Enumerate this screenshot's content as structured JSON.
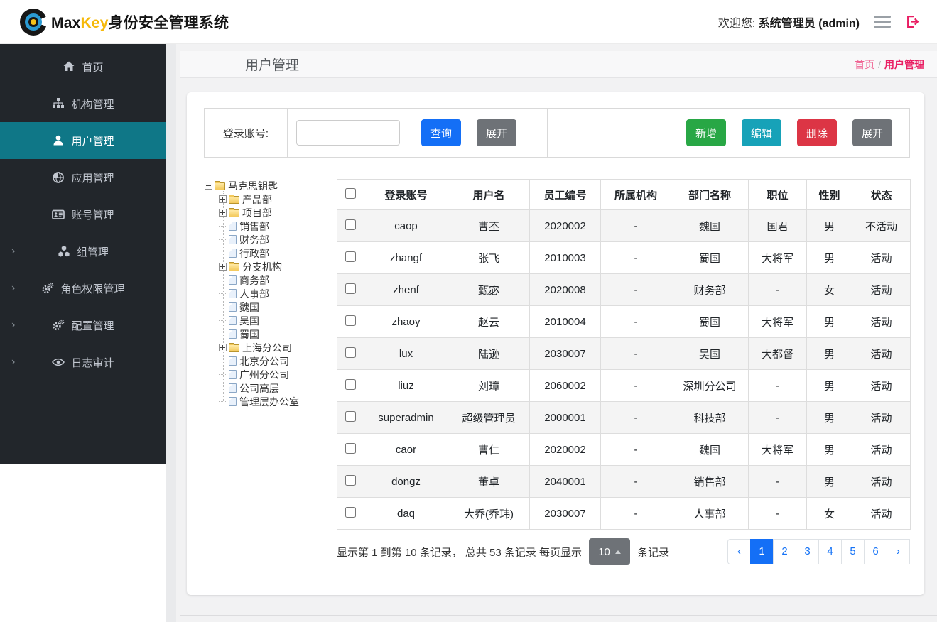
{
  "brand": {
    "logo_max": "Max",
    "logo_key": "Key",
    "logo_suffix": "身份安全管理系统"
  },
  "topbar": {
    "welcome_prefix": "欢迎您:",
    "welcome_user": "系统管理员 (admin)"
  },
  "sidebar": {
    "chevron_glyph": "›",
    "items": [
      {
        "label": "首页",
        "icon": "home-icon",
        "active": false,
        "chevron": false
      },
      {
        "label": "机构管理",
        "icon": "sitemap-icon",
        "active": false,
        "chevron": false
      },
      {
        "label": "用户管理",
        "icon": "user-icon",
        "active": true,
        "chevron": false
      },
      {
        "label": "应用管理",
        "icon": "globe-icon",
        "active": false,
        "chevron": false
      },
      {
        "label": "账号管理",
        "icon": "id-card-icon",
        "active": false,
        "chevron": false
      },
      {
        "label": "组管理",
        "icon": "cubes-icon",
        "active": false,
        "chevron": true
      },
      {
        "label": "角色权限管理",
        "icon": "gears-icon",
        "active": false,
        "chevron": true
      },
      {
        "label": "配置管理",
        "icon": "gears-icon",
        "active": false,
        "chevron": true
      },
      {
        "label": "日志审计",
        "icon": "eye-icon",
        "active": false,
        "chevron": true
      }
    ]
  },
  "page_header": {
    "title": "用户管理",
    "breadcrumb_root": "首页",
    "breadcrumb_sep": "/",
    "breadcrumb_current": "用户管理"
  },
  "search_panel": {
    "label": "登录账号:",
    "input_value": "",
    "query": "查询",
    "expand": "展开"
  },
  "action_buttons": [
    {
      "label": "新增",
      "style": "success"
    },
    {
      "label": "编辑",
      "style": "info"
    },
    {
      "label": "删除",
      "style": "danger"
    },
    {
      "label": "展开",
      "style": "secondary"
    }
  ],
  "tree": {
    "nodes": [
      {
        "label": "马克思钥匙",
        "icon": "folder-open",
        "expander": "minus",
        "root": true
      },
      {
        "label": "产品部",
        "icon": "folder",
        "expander": "plus"
      },
      {
        "label": "项目部",
        "icon": "folder",
        "expander": "plus"
      },
      {
        "label": "销售部",
        "icon": "file",
        "expander": "none"
      },
      {
        "label": "财务部",
        "icon": "file",
        "expander": "none"
      },
      {
        "label": "行政部",
        "icon": "file",
        "expander": "none"
      },
      {
        "label": "分支机构",
        "icon": "folder",
        "expander": "plus"
      },
      {
        "label": "商务部",
        "icon": "file",
        "expander": "none"
      },
      {
        "label": "人事部",
        "icon": "file",
        "expander": "none"
      },
      {
        "label": "魏国",
        "icon": "file",
        "expander": "none"
      },
      {
        "label": "吴国",
        "icon": "file",
        "expander": "none"
      },
      {
        "label": "蜀国",
        "icon": "file",
        "expander": "none"
      },
      {
        "label": "上海分公司",
        "icon": "folder",
        "expander": "plus"
      },
      {
        "label": "北京分公司",
        "icon": "file",
        "expander": "none"
      },
      {
        "label": "广州分公司",
        "icon": "file",
        "expander": "none"
      },
      {
        "label": "公司高层",
        "icon": "file",
        "expander": "none"
      },
      {
        "label": "管理层办公室",
        "icon": "file",
        "expander": "none"
      }
    ]
  },
  "table": {
    "columns": [
      "登录账号",
      "用户名",
      "员工编号",
      "所属机构",
      "部门名称",
      "职位",
      "性别",
      "状态"
    ],
    "rows": [
      [
        "caop",
        "曹丕",
        "2020002",
        "-",
        "魏国",
        "国君",
        "男",
        "不活动"
      ],
      [
        "zhangf",
        "张飞",
        "2010003",
        "-",
        "蜀国",
        "大将军",
        "男",
        "活动"
      ],
      [
        "zhenf",
        "甄宓",
        "2020008",
        "-",
        "财务部",
        "-",
        "女",
        "活动"
      ],
      [
        "zhaoy",
        "赵云",
        "2010004",
        "-",
        "蜀国",
        "大将军",
        "男",
        "活动"
      ],
      [
        "lux",
        "陆逊",
        "2030007",
        "-",
        "吴国",
        "大都督",
        "男",
        "活动"
      ],
      [
        "liuz",
        "刘璋",
        "2060002",
        "-",
        "深圳分公司",
        "-",
        "男",
        "活动"
      ],
      [
        "superadmin",
        "超级管理员",
        "2000001",
        "-",
        "科技部",
        "-",
        "男",
        "活动"
      ],
      [
        "caor",
        "曹仁",
        "2020002",
        "-",
        "魏国",
        "大将军",
        "男",
        "活动"
      ],
      [
        "dongz",
        "董卓",
        "2040001",
        "-",
        "销售部",
        "-",
        "男",
        "活动"
      ],
      [
        "daq",
        "大乔(乔玮)",
        "2030007",
        "-",
        "人事部",
        "-",
        "女",
        "活动"
      ]
    ]
  },
  "pagination": {
    "summary_prefix": "显示第 1 到第 10 条记录， 总共 53 条记录 每页显示",
    "page_size": "10",
    "summary_suffix": "条记录",
    "pages": [
      {
        "label": "‹"
      },
      {
        "label": "1",
        "active": true
      },
      {
        "label": "2"
      },
      {
        "label": "3"
      },
      {
        "label": "4"
      },
      {
        "label": "5"
      },
      {
        "label": "6"
      },
      {
        "label": "›"
      }
    ]
  },
  "colors": {
    "sidebar_bg": "#22262b",
    "active_teal": "#0f7787",
    "breadcrumb_pink": "#e91e63",
    "primary_blue": "#146ff6",
    "success_green": "#28a745",
    "info_teal": "#17a2b8",
    "danger_red": "#dc3545",
    "secondary_gray": "#6e7277",
    "brand_yellow": "#f6b90a"
  }
}
